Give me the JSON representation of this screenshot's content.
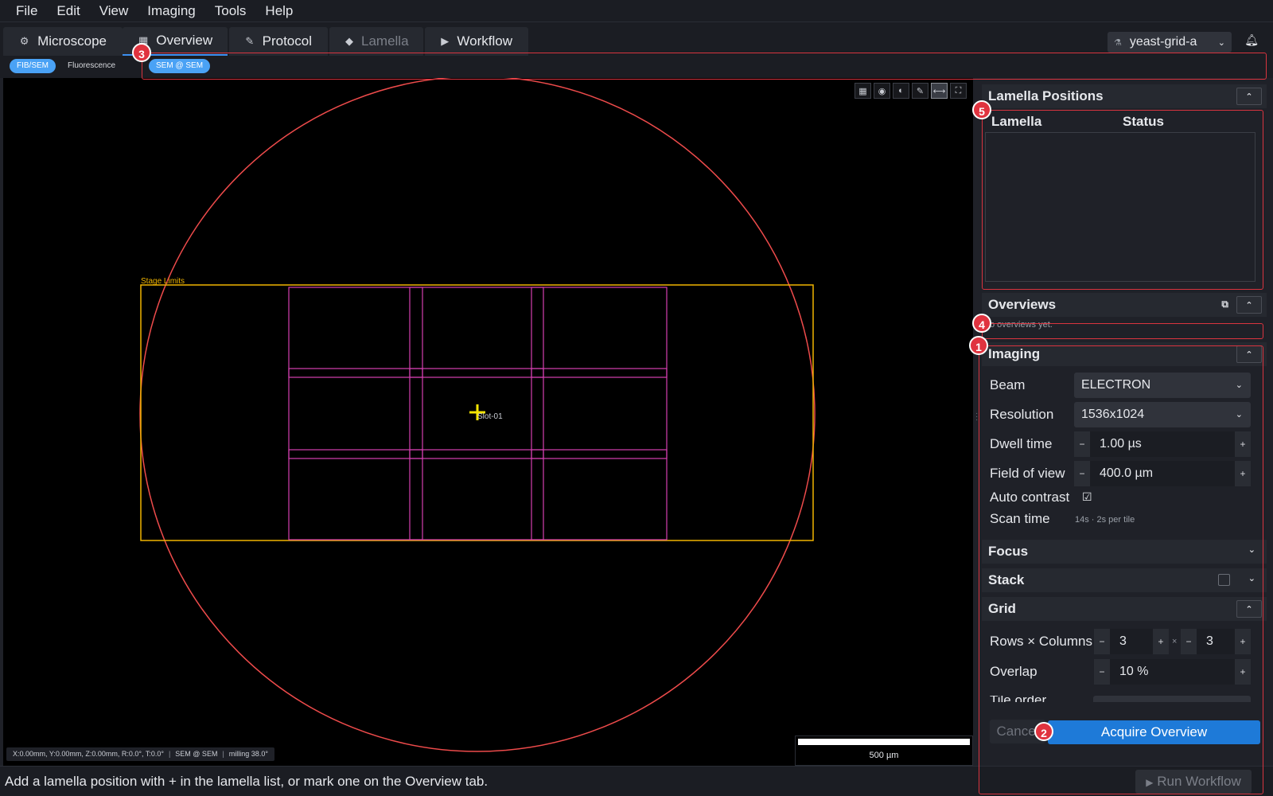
{
  "menubar": {
    "items": [
      "File",
      "Edit",
      "View",
      "Imaging",
      "Tools",
      "Help"
    ]
  },
  "tabs": [
    {
      "label": "Microscope",
      "icon": "microscope-icon",
      "glyph": "⚙"
    },
    {
      "label": "Overview",
      "icon": "map-icon",
      "glyph": "▦",
      "active": true
    },
    {
      "label": "Protocol",
      "icon": "document-icon",
      "glyph": "✎"
    },
    {
      "label": "Lamella",
      "icon": "layers-icon",
      "glyph": "◆",
      "disabled": true
    },
    {
      "label": "Workflow",
      "icon": "play-circle-icon",
      "glyph": "▶"
    }
  ],
  "project": {
    "name": "yeast-grid-a",
    "icon": "flask-icon"
  },
  "subtabs": {
    "fibsem": "FIB/SEM",
    "fluorescence": "Fluorescence",
    "image_source": "SEM @ SEM"
  },
  "viewer": {
    "stage_limits_label": "Stage Limits",
    "slot_label": "Slot-01",
    "tools": [
      "grid-icon",
      "eye-icon",
      "contrast-icon",
      "pencil-icon",
      "ruler-icon",
      "fit-view-icon"
    ],
    "status": {
      "coords": "X:0.00mm, Y:0.00mm, Z:0.00mm, R:0.0°, T:0.0°",
      "source": "SEM @ SEM",
      "milling": "milling 38.0°"
    },
    "scalebar_label": "500 µm"
  },
  "lamella_positions": {
    "title": "Lamella Positions",
    "col_lamella": "Lamella",
    "col_status": "Status",
    "rows": []
  },
  "overviews": {
    "title": "Overviews",
    "empty": "No overviews yet."
  },
  "imaging": {
    "title": "Imaging",
    "beam_label": "Beam",
    "beam_value": "ELECTRON",
    "resolution_label": "Resolution",
    "resolution_value": "1536x1024",
    "dwell_label": "Dwell time",
    "dwell_value": "1.00  µs",
    "fov_label": "Field of view",
    "fov_value": "400.0  µm",
    "auto_contrast_label": "Auto contrast",
    "auto_contrast": true,
    "scan_time_label": "Scan time",
    "scan_time_value": "14s  ·  2s per tile"
  },
  "focus": {
    "title": "Focus"
  },
  "stack": {
    "title": "Stack"
  },
  "grid": {
    "title": "Grid",
    "rows_cols_label": "Rows × Columns",
    "rows": "3",
    "cols": "3",
    "times": "×",
    "overlap_label": "Overlap",
    "overlap_value": "10  %",
    "tile_order_label": "Tile order"
  },
  "actions": {
    "cancel": "Cancel",
    "acquire": "Acquire Overview"
  },
  "statusbar": {
    "message": "Add a lamella position with + in the lamella list, or mark one on the Overview tab.",
    "run_workflow": "Run Workflow"
  },
  "annotations": [
    "1",
    "2",
    "3",
    "4",
    "5"
  ],
  "colors": {
    "accent": "#1e7ad8",
    "annotation": "#e0333f",
    "stage_limits": "#f0b400",
    "tiles": "#d43fb0",
    "grid_circle": "#ee4b4b",
    "marker": "#f5e400"
  }
}
